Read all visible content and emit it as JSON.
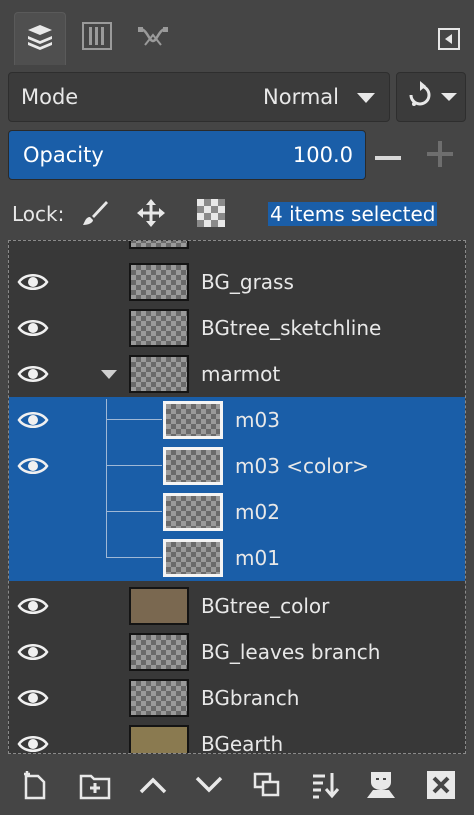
{
  "tabs": [
    {
      "icon": "layers-icon"
    },
    {
      "icon": "channels-icon"
    },
    {
      "icon": "paths-icon"
    }
  ],
  "tab_menu_icon": "tab-menu-icon",
  "mode": {
    "label": "Mode",
    "value": "Normal"
  },
  "opacity": {
    "label": "Opacity",
    "value": "100.0"
  },
  "lock": {
    "label": "Lock:",
    "icons": [
      "lock-pixels-icon",
      "lock-position-icon",
      "lock-alpha-icon"
    ]
  },
  "selection_status": "4 items selected",
  "layers": [
    {
      "name": "BG_grass",
      "visible": true,
      "selected": false
    },
    {
      "name": "BGtree_sketchline",
      "visible": true,
      "selected": false
    },
    {
      "name": "marmot",
      "visible": true,
      "selected": false,
      "group": true
    },
    {
      "name": "m03",
      "visible": true,
      "selected": true
    },
    {
      "name": "m03 <color>",
      "visible": true,
      "selected": true
    },
    {
      "name": "m02",
      "visible": false,
      "selected": true
    },
    {
      "name": "m01",
      "visible": false,
      "selected": true
    },
    {
      "name": "BGtree_color",
      "visible": true,
      "selected": false
    },
    {
      "name": "BG_leaves branch",
      "visible": true,
      "selected": false
    },
    {
      "name": "BGbranch",
      "visible": true,
      "selected": false
    },
    {
      "name": "BGearth",
      "visible": true,
      "selected": false
    }
  ],
  "bottom_actions": [
    "new-layer-icon",
    "new-group-icon",
    "raise-layer-icon",
    "lower-layer-icon",
    "duplicate-layer-icon",
    "merge-down-icon",
    "mask-icon",
    "delete-layer-icon"
  ],
  "colors": {
    "selection": "#1a5ea8",
    "background": "#454545",
    "list_background": "#383838"
  }
}
